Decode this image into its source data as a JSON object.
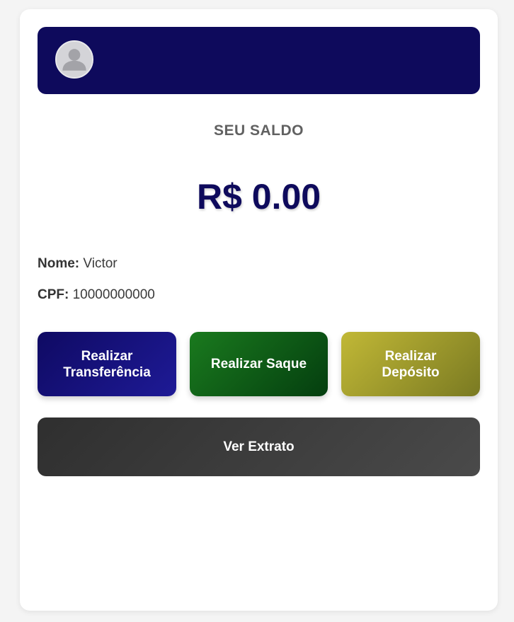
{
  "header": {
    "avatar_icon": "user-avatar-icon",
    "background_color": "#0e0a5c"
  },
  "balance": {
    "label": "SEU SALDO",
    "value": "R$ 0.00"
  },
  "user": {
    "name_label": "Nome:",
    "name_value": "Victor",
    "cpf_label": "CPF:",
    "cpf_value": "10000000000"
  },
  "actions": {
    "transfer_label": "Realizar Transferência",
    "saque_label": "Realizar Saque",
    "deposito_label": "Realizar Depósito",
    "extrato_label": "Ver Extrato"
  },
  "colors": {
    "primary": "#0e0a5c",
    "saque": "#0f5e18",
    "deposito": "#a7a12e",
    "extrato": "#3c3c3c"
  }
}
